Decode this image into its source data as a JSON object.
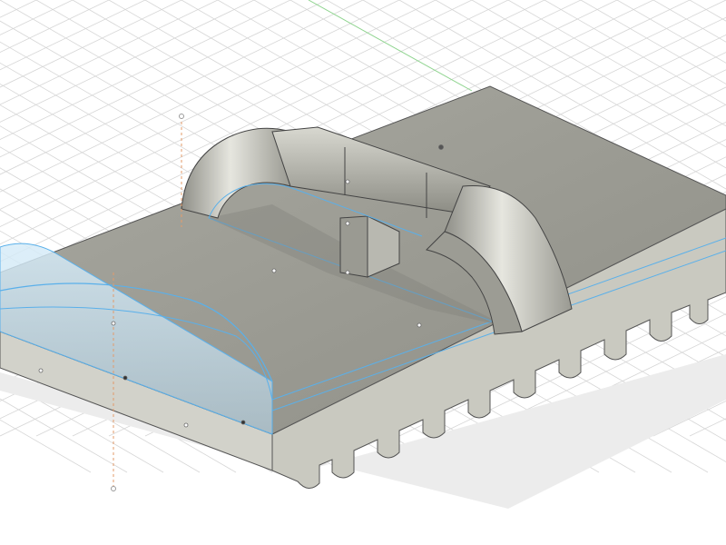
{
  "viewport": {
    "background": "#ffffff",
    "grid_color": "#d6d6d6",
    "grid_minor_color": "#e8e8e8",
    "x_axis_color": "#e07a6e",
    "y_axis_color": "#7fcf7f",
    "z_axis_color": "#e0a060"
  },
  "model": {
    "body_top_color": "#9b9b94",
    "body_side_color": "#bdbdb4",
    "body_front_color": "#c8c8bf",
    "teeth_color": "#b8b8ae",
    "handle_color": "#b5b5ae",
    "handle_highlight": "#e8e8e2",
    "sketch_line_color": "#4aa6e8",
    "selection_fill": "#cfe6f5",
    "shadow_color": "#dcdcdc"
  },
  "labels": []
}
